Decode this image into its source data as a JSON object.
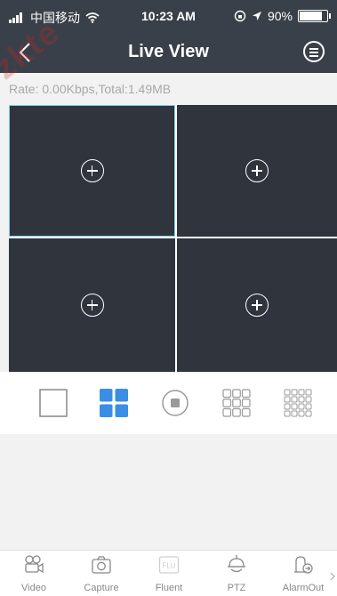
{
  "status_bar": {
    "carrier": "中国移动",
    "time": "10:23 AM",
    "battery": "90%",
    "battery_level": 0.9
  },
  "nav": {
    "title": "Live View"
  },
  "rate_text": "Rate: 0.00Kbps,Total:1.49MB",
  "tabs": [
    {
      "label": "Video",
      "icon": "video-camera-icon"
    },
    {
      "label": "Capture",
      "icon": "camera-icon"
    },
    {
      "label": "Fluent",
      "icon": "fluent-quality-icon"
    },
    {
      "label": "PTZ",
      "icon": "ptz-dome-icon"
    },
    {
      "label": "AlarmOut",
      "icon": "alarm-out-icon"
    }
  ],
  "colors": {
    "header": "#3a4049",
    "accent": "#3a8ee6",
    "selected_border": "#7fd3e8",
    "cell_bg": "#2f343d"
  },
  "watermark": "zkte"
}
